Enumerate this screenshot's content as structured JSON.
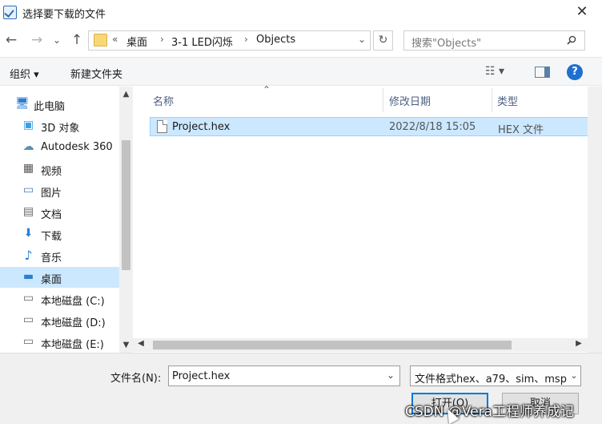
{
  "window": {
    "title": "选择要下载的文件",
    "close_symbol": "✕"
  },
  "nav": {
    "back_symbol": "←",
    "forward_symbol": "→",
    "recent_symbol": "⌄",
    "up_symbol": "↑"
  },
  "address": {
    "overflow": "«",
    "crumbs": [
      "桌面",
      "3-1 LED闪烁",
      "Objects"
    ],
    "separator": "›",
    "dropdown_symbol": "⌄",
    "refresh_symbol": "↻"
  },
  "search": {
    "placeholder": "搜索\"Objects\""
  },
  "toolbar": {
    "organize": "组织 ▾",
    "new_folder": "新建文件夹",
    "view_symbol": "☷ ▾",
    "help_symbol": "?"
  },
  "sidebar": {
    "items": [
      {
        "label": "此电脑",
        "icon": "computer-icon",
        "glyph": "🖥"
      },
      {
        "label": "3D 对象",
        "icon": "cube-icon",
        "glyph": "▣"
      },
      {
        "label": "Autodesk 360",
        "icon": "cloud-icon",
        "glyph": "☁"
      },
      {
        "label": "视频",
        "icon": "video-icon",
        "glyph": "▦"
      },
      {
        "label": "图片",
        "icon": "picture-icon",
        "glyph": "▭"
      },
      {
        "label": "文档",
        "icon": "document-icon",
        "glyph": "▤"
      },
      {
        "label": "下载",
        "icon": "download-arrow-icon",
        "glyph": "⬇"
      },
      {
        "label": "音乐",
        "icon": "music-note-icon",
        "glyph": "♪"
      },
      {
        "label": "桌面",
        "icon": "desktop-icon",
        "glyph": "▬"
      },
      {
        "label": "本地磁盘 (C:)",
        "icon": "drive-icon",
        "glyph": "▭"
      },
      {
        "label": "本地磁盘 (D:)",
        "icon": "drive-icon",
        "glyph": "▭"
      },
      {
        "label": "本地磁盘 (E:)",
        "icon": "drive-icon",
        "glyph": "▭"
      }
    ],
    "selected_index": 8
  },
  "columns": {
    "name": "名称",
    "modified": "修改日期",
    "type": "类型"
  },
  "files": [
    {
      "name": "Project.hex",
      "modified": "2022/8/18 15:05",
      "type": "HEX 文件"
    }
  ],
  "bottom": {
    "filename_label": "文件名(N):",
    "filename_value": "Project.hex",
    "filter_value": "文件格式hex、a79、sim、msp",
    "open_button": "打开(O)",
    "cancel_button": "取消"
  },
  "watermark": "CSDN @Vera工程师养成记",
  "colors": {
    "selection": "#cce8ff",
    "accent": "#0078d7",
    "help": "#1e6fd0"
  }
}
